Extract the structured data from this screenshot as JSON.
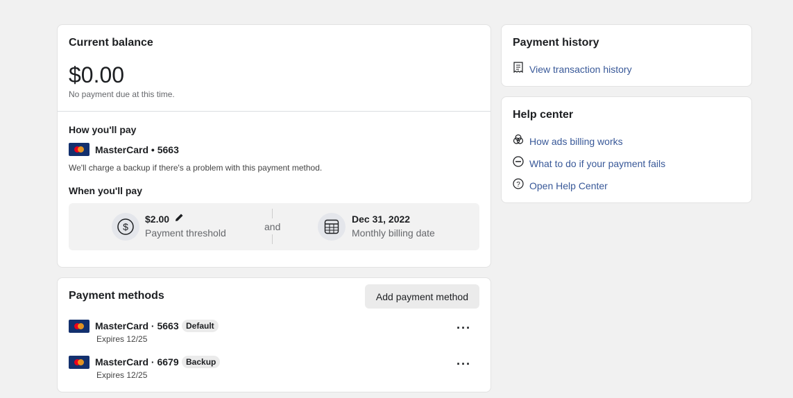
{
  "balance": {
    "title": "Current balance",
    "amount": "$0.00",
    "note": "No payment due at this time."
  },
  "how_pay": {
    "title": "How you'll pay",
    "card_label": "MasterCard • 5663",
    "note": "We'll charge a backup if there's a problem with this payment method."
  },
  "when_pay": {
    "title": "When you'll pay",
    "threshold_value": "$2.00",
    "threshold_label": "Payment threshold",
    "connector": "and",
    "date_value": "Dec 31, 2022",
    "date_label": "Monthly billing date"
  },
  "payment_methods": {
    "title": "Payment methods",
    "add_button": "Add payment method",
    "items": [
      {
        "name": "MasterCard · 5663",
        "badge": "Default",
        "expires": "Expires 12/25"
      },
      {
        "name": "MasterCard · 6679",
        "badge": "Backup",
        "expires": "Expires 12/25"
      }
    ]
  },
  "history": {
    "title": "Payment history",
    "link": "View transaction history"
  },
  "help": {
    "title": "Help center",
    "links": [
      "How ads billing works",
      "What to do if your payment fails",
      "Open Help Center"
    ]
  },
  "colors": {
    "link": "#385898",
    "mastercard_bg": "#13306e"
  }
}
